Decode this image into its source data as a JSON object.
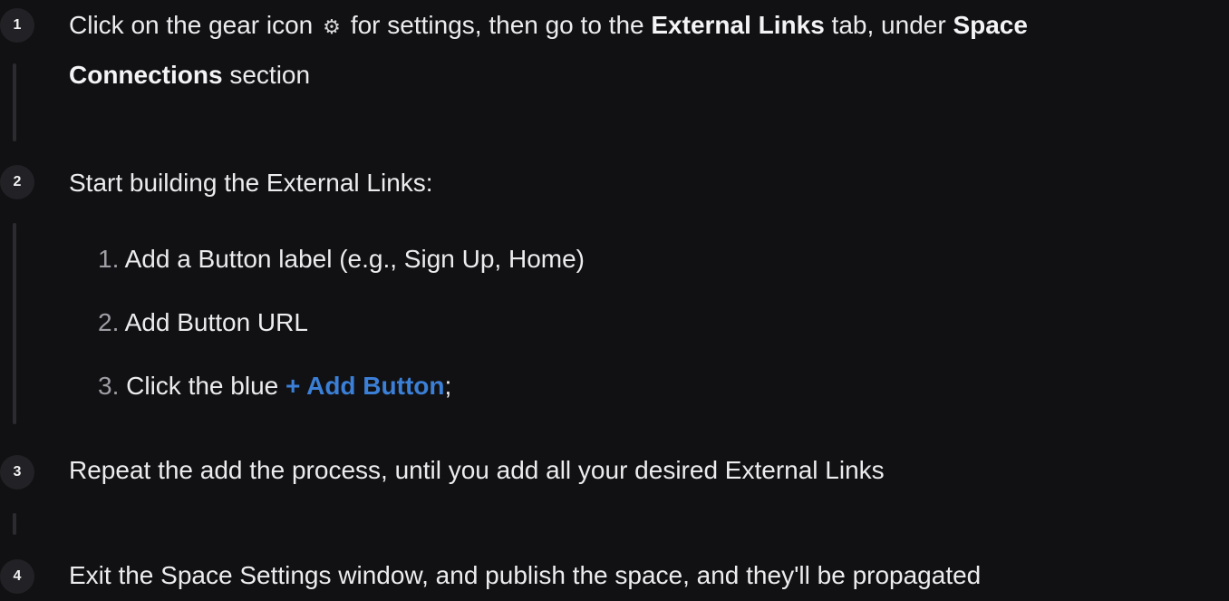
{
  "steps": [
    {
      "number": "1",
      "text_a": "Click on the gear icon ",
      "gear_glyph": "⚙",
      "text_b": " for settings, then go to the ",
      "bold_a": "External Links",
      "text_c": " tab, under ",
      "bold_b": "Space",
      "bold_c": "Connections",
      "text_d": " section"
    },
    {
      "number": "2",
      "text": "Start building the External Links:",
      "substeps": [
        {
          "num": "1.",
          "text": " Add a Button label (e.g., Sign Up, Home)"
        },
        {
          "num": "2.",
          "text": " Add Button URL"
        },
        {
          "num": "3.",
          "text_a": " Click the blue ",
          "link": "+ Add Button",
          "text_b": ";"
        }
      ]
    },
    {
      "number": "3",
      "text": "Repeat the add the process, until you add all your desired External Links"
    },
    {
      "number": "4",
      "text": "Exit the Space Settings window, and publish the space, and they'll be propagated"
    }
  ]
}
